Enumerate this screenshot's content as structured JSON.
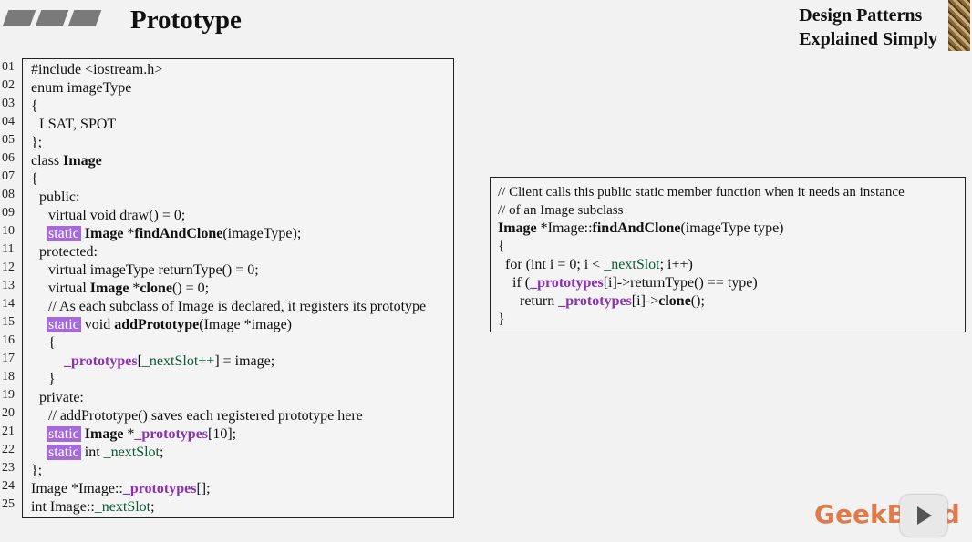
{
  "header": {
    "title": "Prototype",
    "brand_line1": "Design Patterns",
    "brand_line2": "Explained Simply"
  },
  "line_numbers": [
    "01",
    "02",
    "03",
    "04",
    "05",
    "06",
    "07",
    "08",
    "09",
    "10",
    "11",
    "12",
    "13",
    "14",
    "15",
    "16",
    "17",
    "18",
    "19",
    "20",
    "21",
    "22",
    "23",
    "24",
    "25"
  ],
  "code": {
    "l01": "#include <iostream.h>",
    "l02": "enum imageType",
    "l03": "{",
    "l04": "LSAT, SPOT",
    "l05": "};",
    "l06_a": "class ",
    "l06_b": "Image",
    "l07": "{",
    "l08": "public:",
    "l09": "virtual void draw() = 0;",
    "l10_kw": "static",
    "l10_b": " Image",
    "l10_c": " *",
    "l10_d": "findAndClone",
    "l10_e": "(imageType);",
    "l11": "protected:",
    "l12": "virtual imageType returnType() = 0;",
    "l13_a": "virtual ",
    "l13_b": "Image",
    "l13_c": " *",
    "l13_d": "clone",
    "l13_e": "() = 0;",
    "l14": "// As each subclass of Image is declared, it registers its prototype",
    "l15_kw": "static",
    "l15_a": " void ",
    "l15_b": "addPrototype",
    "l15_c": "(Image *image)",
    "l16": "{",
    "l17_a": "_prototypes",
    "l17_b": "[",
    "l17_c": "_nextSlot++",
    "l17_d": "] = image;",
    "l18": "}",
    "l19": "private:",
    "l20": "// addPrototype() saves each registered prototype here",
    "l21_kw": "static",
    "l21_a": " Image",
    "l21_b": " *",
    "l21_c": "_prototypes",
    "l21_d": "[10];",
    "l22_kw": "static",
    "l22_a": " int ",
    "l22_b": "_nextSlot",
    "l22_c": ";",
    "l23": "};",
    "l24_a": "Image *Image::",
    "l24_b": "_prototypes",
    "l24_c": "[];",
    "l25_a": "int Image::",
    "l25_b": "_nextSlot",
    "l25_c": ";"
  },
  "client": {
    "c1": "// Client calls this public static member function when it needs an instance",
    "c2": "// of an Image subclass",
    "c3_a": "Image",
    "c3_b": " *Image::",
    "c3_c": "findAndClone",
    "c3_d": "(imageType type)",
    "c4": "{",
    "c5_a": "for (int i = 0; i < ",
    "c5_b": "_nextSlot",
    "c5_c": "; i++)",
    "c6_a": "if (",
    "c6_b": "_prototypes",
    "c6_c": "[i]->returnType() == type)",
    "c7_a": "return ",
    "c7_b": "_prototypes",
    "c7_c": "[i]->",
    "c7_d": "clone",
    "c7_e": "();",
    "c8": "}"
  },
  "logo": "GeekBand"
}
